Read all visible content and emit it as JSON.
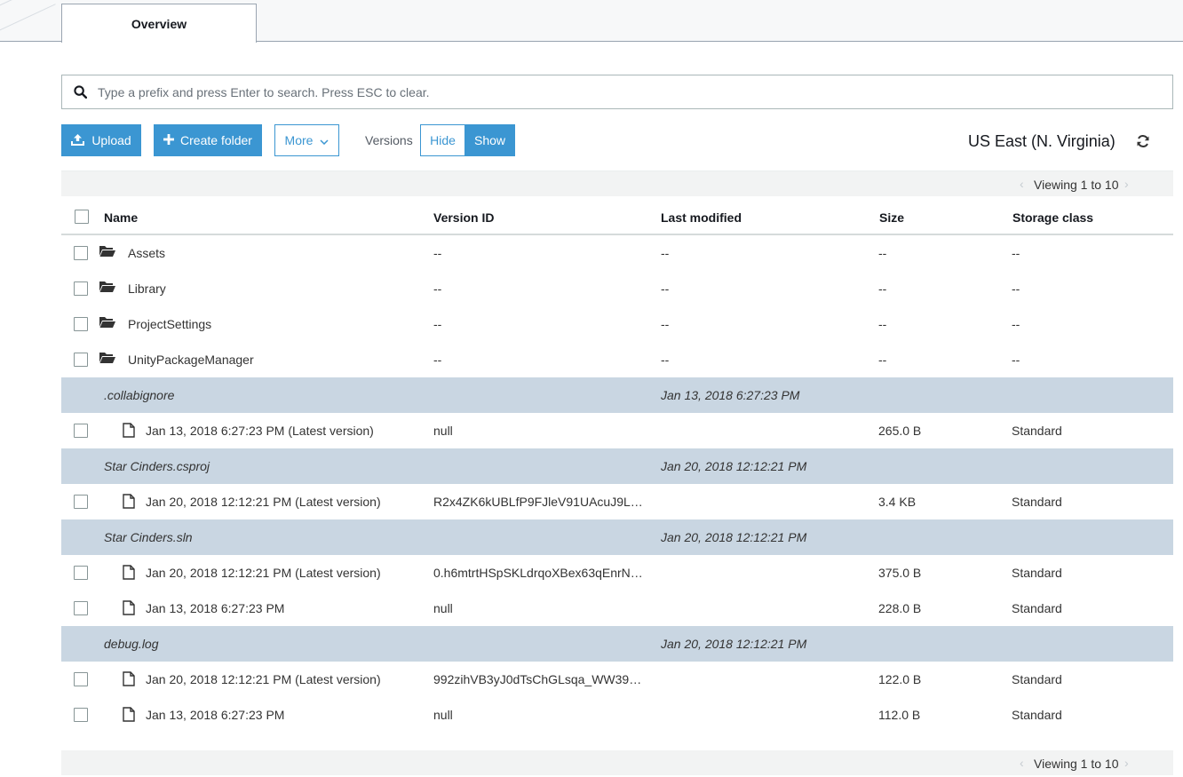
{
  "tabs": [
    {
      "label": "Overview"
    }
  ],
  "search": {
    "placeholder": "Type a prefix and press Enter to search. Press ESC to clear."
  },
  "toolbar": {
    "upload": "Upload",
    "create_folder": "Create folder",
    "more": "More",
    "versions_label": "Versions",
    "hide": "Hide",
    "show": "Show",
    "region": "US East (N. Virginia)"
  },
  "pagination": {
    "text": "Viewing 1 to 10"
  },
  "table": {
    "headers": {
      "name": "Name",
      "version_id": "Version ID",
      "last_modified": "Last modified",
      "size": "Size",
      "storage_class": "Storage class"
    },
    "folders": [
      {
        "name": "Assets",
        "version_id": "--",
        "last_modified": "--",
        "size": "--",
        "storage_class": "--"
      },
      {
        "name": "Library",
        "version_id": "--",
        "last_modified": "--",
        "size": "--",
        "storage_class": "--"
      },
      {
        "name": "ProjectSettings",
        "version_id": "--",
        "last_modified": "--",
        "size": "--",
        "storage_class": "--"
      },
      {
        "name": "UnityPackageManager",
        "version_id": "--",
        "last_modified": "--",
        "size": "--",
        "storage_class": "--"
      }
    ],
    "groups": [
      {
        "name": ".collabignore",
        "last_modified": "Jan 13, 2018 6:27:23 PM",
        "versions": [
          {
            "label": "Jan 13, 2018 6:27:23 PM (Latest version)",
            "version_id": "null",
            "size": "265.0 B",
            "storage_class": "Standard"
          }
        ]
      },
      {
        "name": "Star Cinders.csproj",
        "last_modified": "Jan 20, 2018 12:12:21 PM",
        "versions": [
          {
            "label": "Jan 20, 2018 12:12:21 PM (Latest version)",
            "version_id": "R2x4ZK6kUBLfP9FJleV91UAcuJ9L…",
            "size": "3.4 KB",
            "storage_class": "Standard"
          }
        ]
      },
      {
        "name": "Star Cinders.sln",
        "last_modified": "Jan 20, 2018 12:12:21 PM",
        "versions": [
          {
            "label": "Jan 20, 2018 12:12:21 PM (Latest version)",
            "version_id": "0.h6mtrtHSpSKLdrqoXBex63qEnrN…",
            "size": "375.0 B",
            "storage_class": "Standard"
          },
          {
            "label": "Jan 13, 2018 6:27:23 PM",
            "version_id": "null",
            "size": "228.0 B",
            "storage_class": "Standard"
          }
        ]
      },
      {
        "name": "debug.log",
        "last_modified": "Jan 20, 2018 12:12:21 PM",
        "versions": [
          {
            "label": "Jan 20, 2018 12:12:21 PM (Latest version)",
            "version_id": "992zihVB3yJ0dTsChGLsqa_WW39…",
            "size": "122.0 B",
            "storage_class": "Standard"
          },
          {
            "label": "Jan 13, 2018 6:27:23 PM",
            "version_id": "null",
            "size": "112.0 B",
            "storage_class": "Standard"
          }
        ]
      }
    ]
  },
  "colors": {
    "primary": "#3b96d2",
    "group_row": "#c9d6e2",
    "pager_bg": "#f2f3f3"
  }
}
